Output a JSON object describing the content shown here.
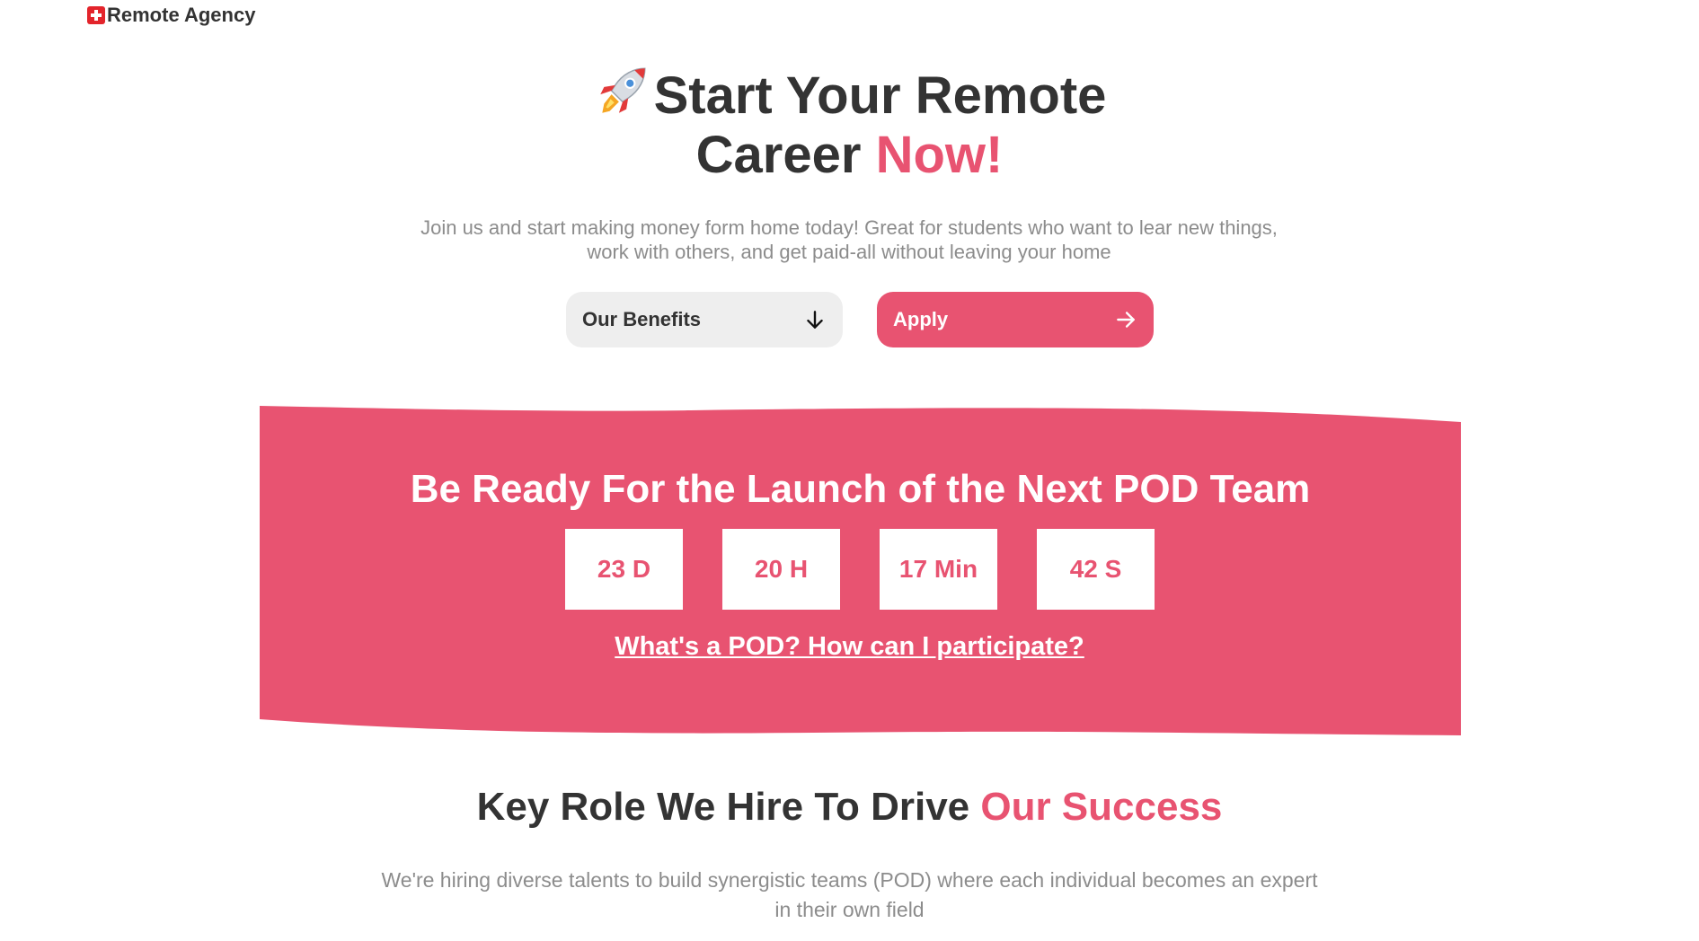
{
  "header": {
    "brand": "Remote Agency",
    "flag_icon": "swiss-flag-icon"
  },
  "hero": {
    "rocket_icon": "rocket-icon",
    "title_line1": "Start Your Remote",
    "title_line2_main": "Career ",
    "title_line2_accent": "Now!",
    "subtitle": "Join us and start making money form home today! Great for students who want to lear new things, work with others, and get paid-all without leaving your home",
    "benefits_button": "Our Benefits",
    "benefits_icon": "arrow-down-icon",
    "apply_button": "Apply",
    "apply_icon": "arrow-right-icon"
  },
  "launch": {
    "title": "Be Ready For the Launch of the Next POD Team",
    "countdown": {
      "days": "23 D",
      "hours": "20 H",
      "minutes": "17 Min",
      "seconds": "42 S"
    },
    "pod_link": "What's a POD? How can I participate?"
  },
  "roles": {
    "title_main": "Key Role We Hire To Drive ",
    "title_accent": "Our Success",
    "subtitle": "We're hiring diverse talents to build synergistic teams (POD) where each individual becomes an expert in their own field"
  },
  "colors": {
    "accent": "#e85371",
    "text": "#333333",
    "muted": "#8c8c8c",
    "button_gray": "#eeeeee"
  }
}
